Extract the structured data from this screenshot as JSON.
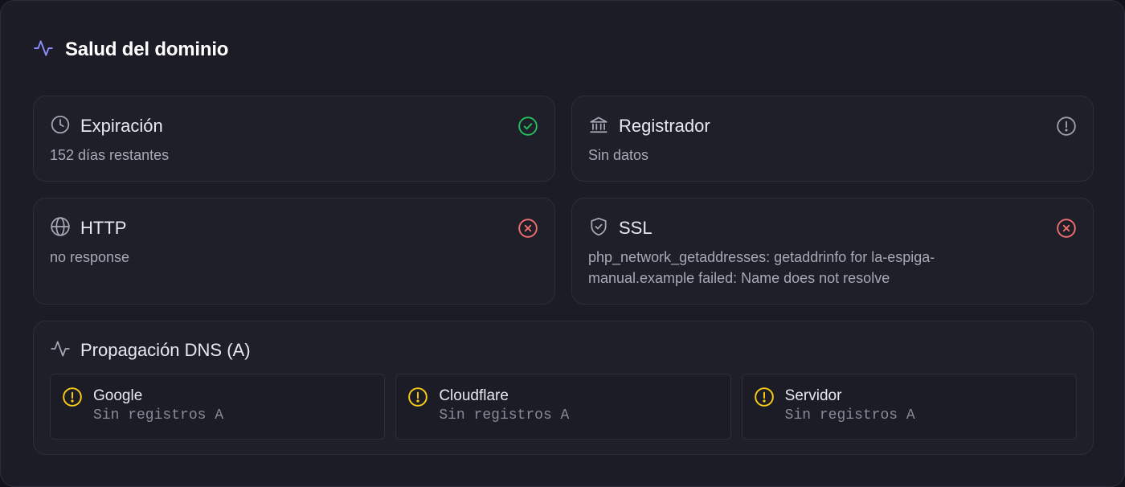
{
  "header": {
    "title": "Salud del dominio",
    "icon": "activity-icon"
  },
  "cards": {
    "expiration": {
      "title": "Expiración",
      "text": "152 días restantes",
      "status": "ok",
      "icon": "clock-icon"
    },
    "registrar": {
      "title": "Registrador",
      "text": "Sin datos",
      "status": "info",
      "icon": "bank-icon"
    },
    "http": {
      "title": "HTTP",
      "text": "no response",
      "status": "error",
      "icon": "globe-icon"
    },
    "ssl": {
      "title": "SSL",
      "text": "php_network_getaddresses: getaddrinfo for la-espiga-manual.example failed: Name does not resolve",
      "status": "error",
      "icon": "shield-icon"
    }
  },
  "dns": {
    "title": "Propagación DNS (A)",
    "resolvers": [
      {
        "name": "Google",
        "value": "Sin registros A",
        "status": "warning"
      },
      {
        "name": "Cloudflare",
        "value": "Sin registros A",
        "status": "warning"
      },
      {
        "name": "Servidor",
        "value": "Sin registros A",
        "status": "warning"
      }
    ]
  },
  "colors": {
    "ok": "#22c55e",
    "error": "#f87171",
    "warning": "#facc15",
    "info": "#a1a1aa",
    "accent": "#8b8cf8"
  }
}
